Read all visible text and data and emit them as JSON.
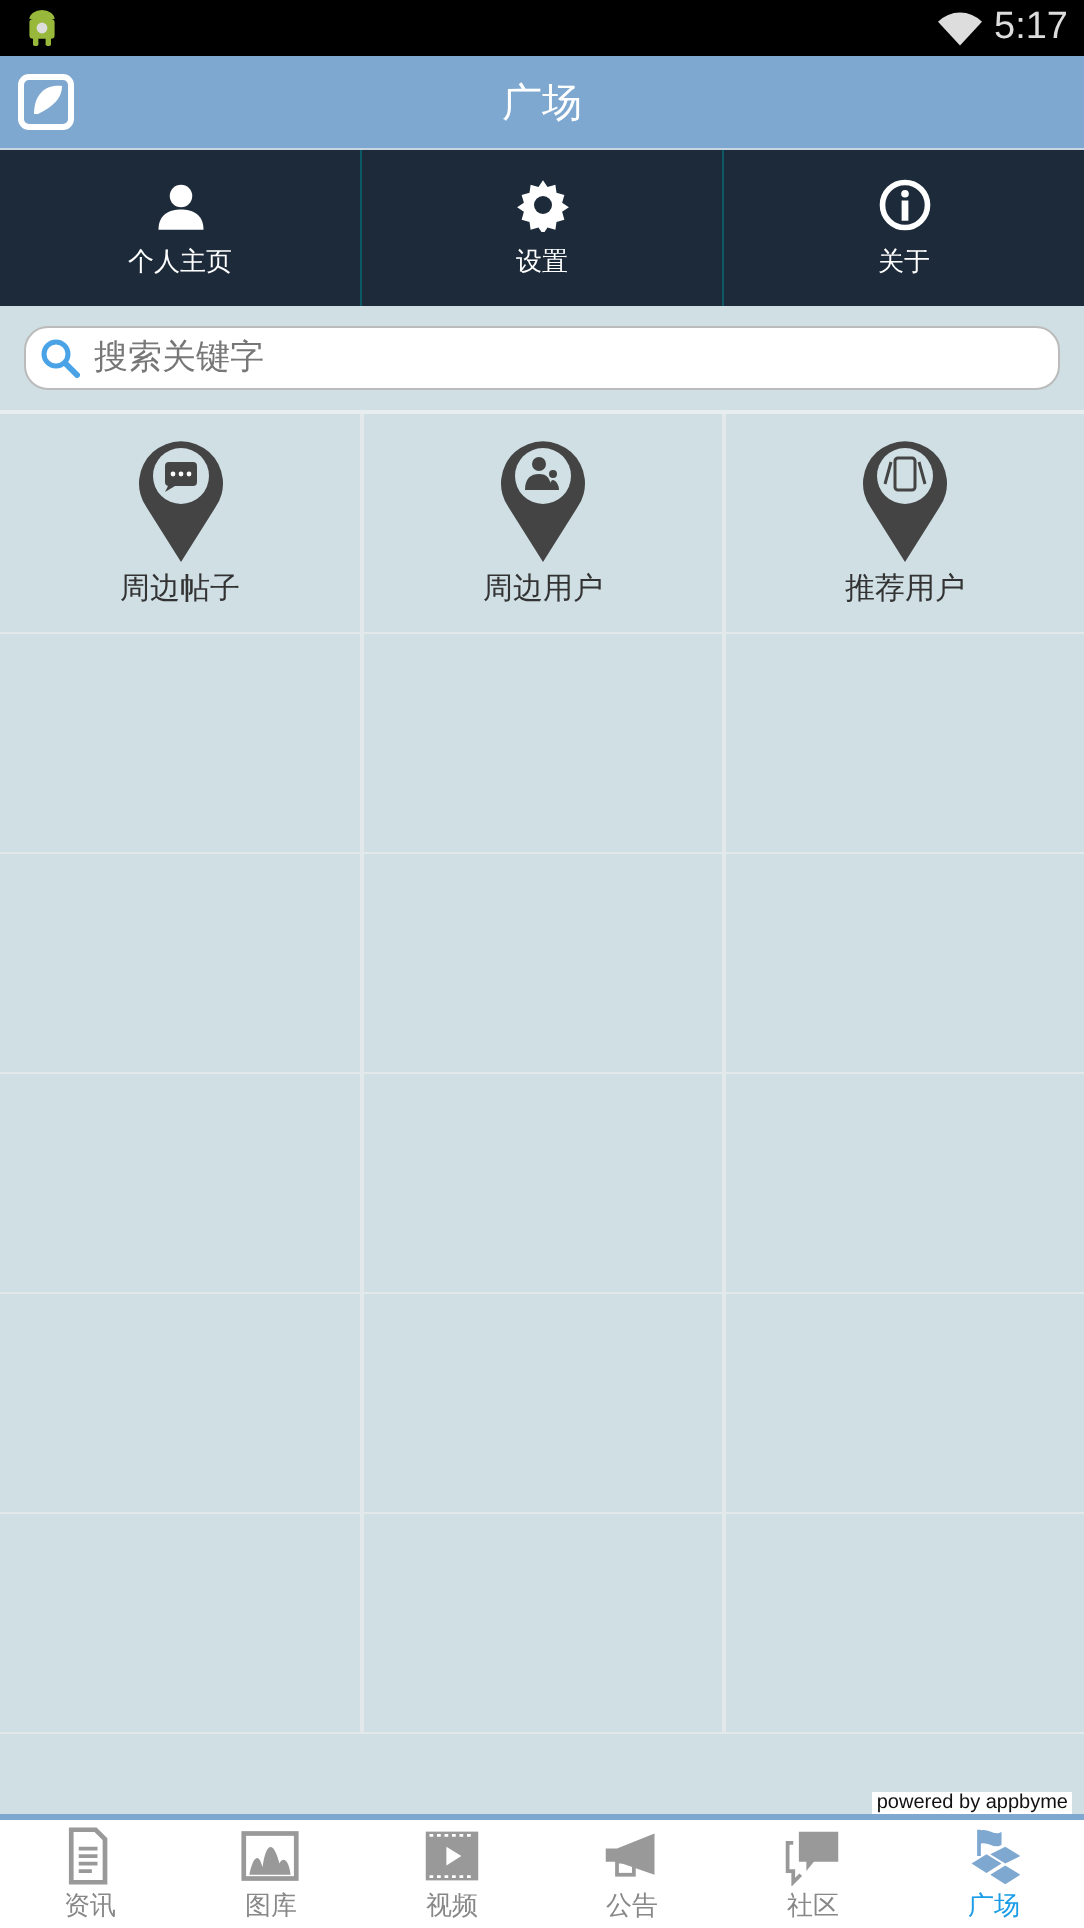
{
  "status_bar": {
    "time": "5:17"
  },
  "header": {
    "title": "广场"
  },
  "nav": [
    {
      "label": "个人主页",
      "kind": "person"
    },
    {
      "label": "设置",
      "kind": "gear"
    },
    {
      "label": "关于",
      "kind": "info"
    }
  ],
  "search": {
    "placeholder": "搜索关键字"
  },
  "grid": [
    {
      "label": "周边帖子",
      "kind": "chat"
    },
    {
      "label": "周边用户",
      "kind": "users"
    },
    {
      "label": "推荐用户",
      "kind": "phones"
    }
  ],
  "footer_note": "powered by appbyme",
  "tabs": [
    {
      "label": "资讯",
      "kind": "doc",
      "selected": false
    },
    {
      "label": "图库",
      "kind": "image",
      "selected": false
    },
    {
      "label": "视频",
      "kind": "film",
      "selected": false
    },
    {
      "label": "公告",
      "kind": "horn",
      "selected": false
    },
    {
      "label": "社区",
      "kind": "bubbles",
      "selected": false
    },
    {
      "label": "广场",
      "kind": "flag",
      "selected": true
    }
  ]
}
